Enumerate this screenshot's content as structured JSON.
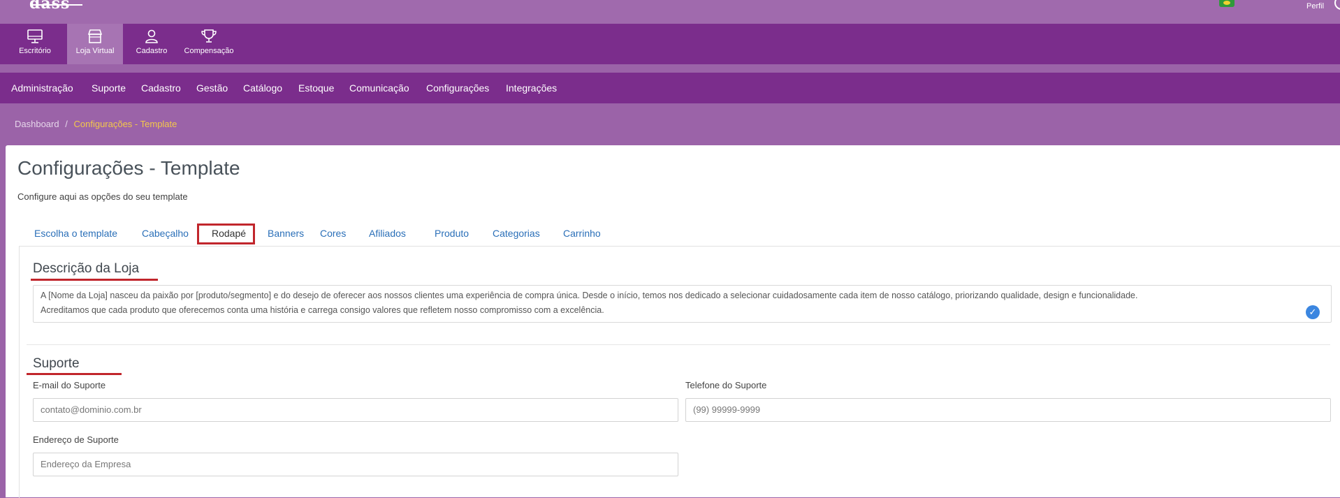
{
  "topbar": {
    "logo": "dass",
    "perfil": "Perfil"
  },
  "modules": [
    {
      "label": "Escritório",
      "icon": "monitor-icon"
    },
    {
      "label": "Loja Virtual",
      "icon": "storefront-icon"
    },
    {
      "label": "Cadastro",
      "icon": "user-icon"
    },
    {
      "label": "Compensação",
      "icon": "trophy-icon"
    }
  ],
  "menu": [
    "Administração",
    "Suporte",
    "Cadastro",
    "Gestão",
    "Catálogo",
    "Estoque",
    "Comunicação",
    "Configurações",
    "Integrações"
  ],
  "breadcrumb": {
    "root": "Dashboard",
    "sep": "/",
    "current": "Configurações - Template"
  },
  "page": {
    "title": "Configurações - Template",
    "subtitle": "Configure aqui as opções do seu template"
  },
  "tabs": [
    "Escolha o template",
    "Cabeçalho",
    "Rodapé",
    "Banners",
    "Cores",
    "Afiliados",
    "Produto",
    "Categorias",
    "Carrinho"
  ],
  "descricao": {
    "title": "Descrição da Loja",
    "text_line1": "A [Nome da Loja] nasceu da paixão por [produto/segmento] e do desejo de oferecer aos nossos clientes uma experiência de compra única. Desde o início, temos nos dedicado a selecionar cuidadosamente cada item de nosso catálogo, priorizando qualidade, design e funcionalidade.",
    "text_line2": "Acreditamos que cada produto que oferecemos conta uma história e carrega consigo valores que refletem nosso compromisso com a excelência."
  },
  "suporte": {
    "title": "Suporte",
    "email_label": "E-mail do Suporte",
    "email_placeholder": "contato@dominio.com.br",
    "telefone_label": "Telefone do Suporte",
    "telefone_placeholder": "(99) 99999-9999",
    "endereco_label": "Endereço de Suporte",
    "endereco_placeholder": "Endereço da Empresa"
  }
}
